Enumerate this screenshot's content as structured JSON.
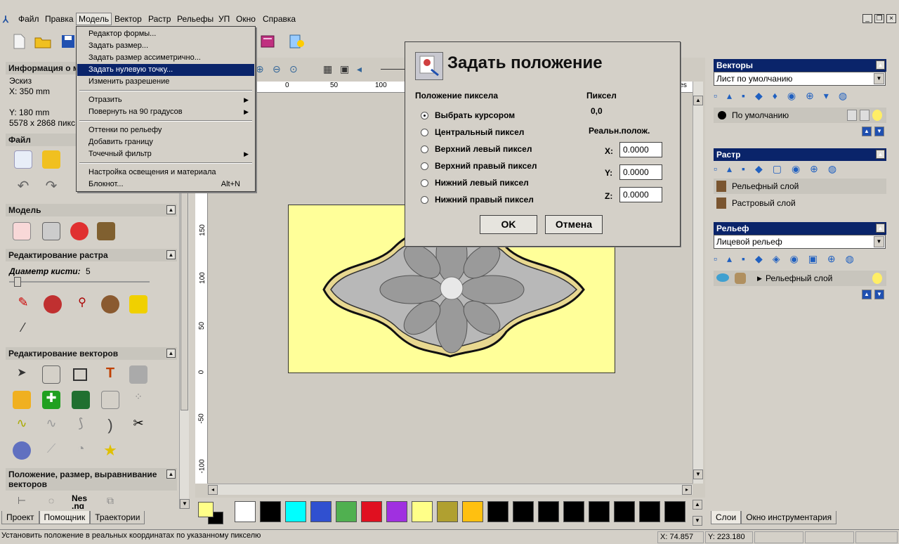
{
  "menubar": {
    "items": [
      "Файл",
      "Правка",
      "Модель",
      "Вектор",
      "Растр",
      "Рельефы",
      "УП",
      "Окно",
      "Справка"
    ]
  },
  "window_buttons": {
    "minimize": "_",
    "restore": "❐",
    "close": "×"
  },
  "model_menu": {
    "items": [
      {
        "label": "Редактор формы..."
      },
      {
        "label": "Задать размер..."
      },
      {
        "label": "Задать размер ассиметрично..."
      },
      {
        "label": "Задать нулевую точку...",
        "highlighted": true
      },
      {
        "label": "Изменить разрешение"
      },
      {
        "label": "Отразить",
        "submenu": true
      },
      {
        "label": "Повернуть на 90 градусов",
        "submenu": true
      },
      {
        "label": "Оттенки по рельефу"
      },
      {
        "label": "Добавить границу"
      },
      {
        "label": "Точечный фильтр",
        "submenu": true
      },
      {
        "label": "Настройка освещения и материала"
      },
      {
        "label": "Блокнот...",
        "shortcut": "Alt+N"
      }
    ]
  },
  "left_panel": {
    "info_title": "Информация о м",
    "info_lines": [
      "Эскиз",
      "X: 350 mm",
      "",
      "Y: 180 mm",
      "5578 x 2868 пикс"
    ],
    "file_title": "Файл",
    "model_title": "Модель",
    "raster_edit_title": "Редактирование растра",
    "brush_label": "Диаметр кисти:",
    "brush_value": "5",
    "vector_edit_title": "Редактирование векторов",
    "position_title": "Положение, размер, выравнивание векторов",
    "nest_label": "Nes\n.ng",
    "tabs": [
      "Проект",
      "Помощник",
      "Траектории"
    ]
  },
  "canvas": {
    "ruler_h": [
      "0",
      "50",
      "100"
    ],
    "ruler_v": [
      "150",
      "100",
      "50",
      "0",
      "-50",
      "-100"
    ],
    "ruler_units": "res"
  },
  "dialog": {
    "title": "Задать положение",
    "pixel_position_label": "Положение пиксела",
    "pixel_label": "Пиксел",
    "pixel_value": "0,0",
    "real_pos_label": "Реальн.полож.",
    "options": [
      {
        "label": "Выбрать курсором",
        "selected": true
      },
      {
        "label": "Центральный пиксел",
        "selected": false
      },
      {
        "label": "Верхний левый пиксел",
        "selected": false
      },
      {
        "label": "Верхний правый пиксел",
        "selected": false
      },
      {
        "label": "Нижний левый пиксел",
        "selected": false
      },
      {
        "label": "Нижний правый пиксел",
        "selected": false
      }
    ],
    "x_label": "X:",
    "x_value": "0.0000",
    "y_label": "Y:",
    "y_value": "0.0000",
    "z_label": "Z:",
    "z_value": "0.0000",
    "ok": "OK",
    "cancel": "Отмена"
  },
  "right_panel": {
    "vectors_title": "Векторы",
    "vectors_sheet": "Лист по умолчанию",
    "vector_layer": "По умолчанию",
    "raster_title": "Растр",
    "raster_layers": [
      "Рельефный слой",
      "Растровый слой"
    ],
    "relief_title": "Рельеф",
    "relief_combo": "Лицевой рельеф",
    "relief_layer": "Рельефный слой",
    "tabs": [
      "Слои",
      "Окно инструментария"
    ]
  },
  "palette": [
    "#ffffff",
    "#000000",
    "#00ffff",
    "#3050d0",
    "#50b050",
    "#e01020",
    "#a030e0",
    "#ffff88",
    "#b0a030",
    "#ffc010",
    "#000000",
    "#000000",
    "#000000",
    "#000000",
    "#000000",
    "#000000",
    "#000000",
    "#000000"
  ],
  "status": {
    "message": "Установить положение в реальных координатах по указанному пикселю",
    "x": "X: 74.857",
    "y": "Y: 223.180"
  }
}
